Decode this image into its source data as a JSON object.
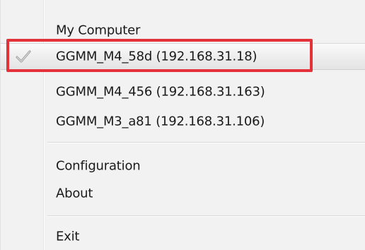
{
  "menu": {
    "items": [
      {
        "label": "My Computer"
      },
      {
        "label": "GGMM_M4_58d (192.168.31.18)",
        "checked": true
      },
      {
        "label": "GGMM_M4_456 (192.168.31.163)"
      },
      {
        "label": "GGMM_M3_a81 (192.168.31.106)"
      },
      {
        "label": "Configuration"
      },
      {
        "label": "About"
      },
      {
        "label": "Exit"
      }
    ]
  },
  "colors": {
    "highlight_border": "#e4323a",
    "menu_background": "#f2f2f2"
  },
  "icons": {
    "checked": "checkmark-icon"
  }
}
